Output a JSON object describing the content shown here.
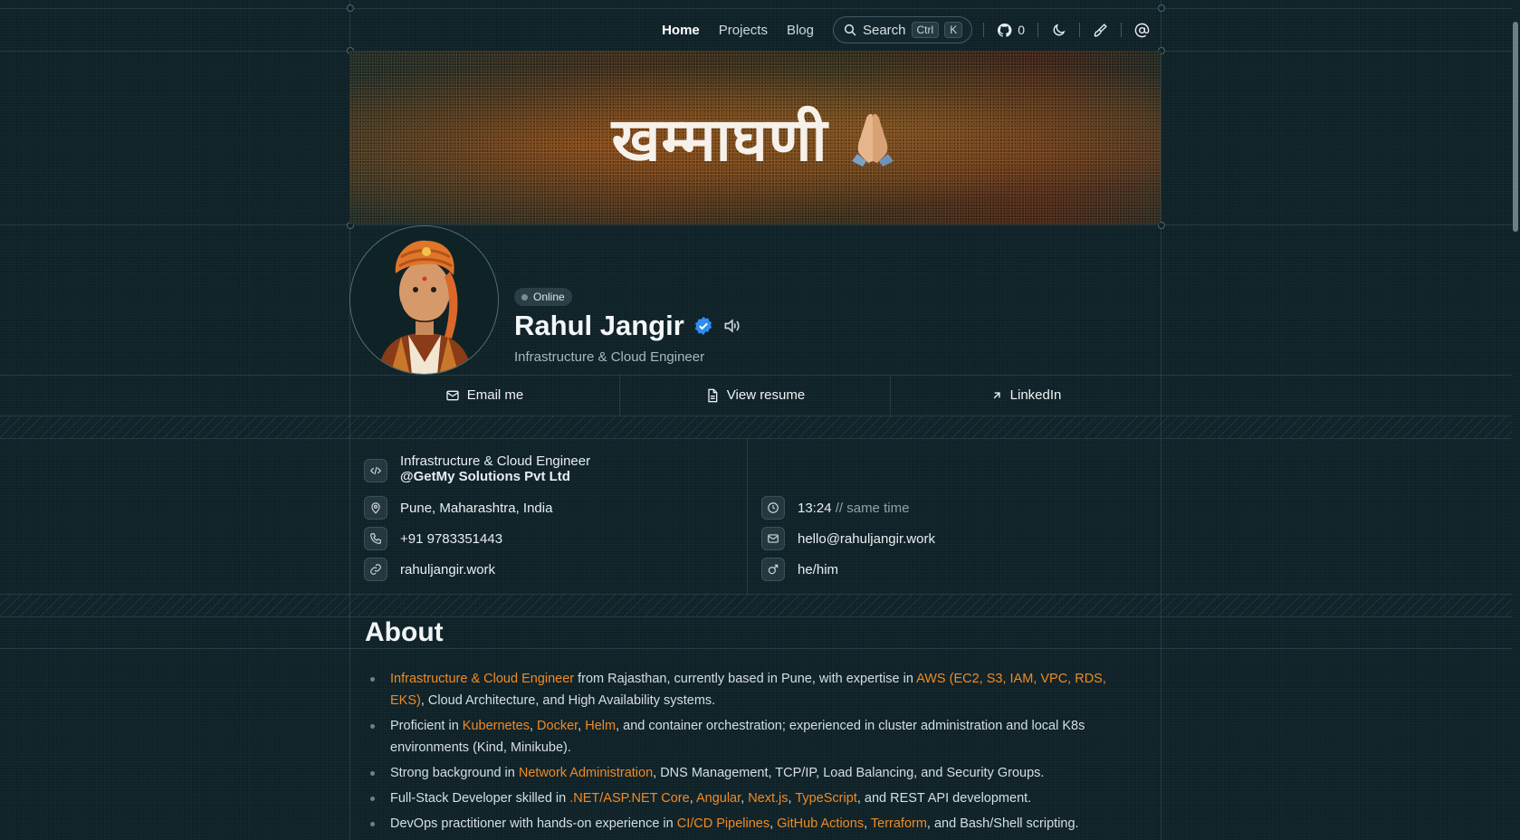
{
  "nav": {
    "links": [
      "Home",
      "Projects",
      "Blog"
    ],
    "search_label": "Search",
    "search_kbd": [
      "Ctrl",
      "K"
    ],
    "github_count": "0"
  },
  "banner": {
    "title": "खम्माघणी"
  },
  "profile": {
    "status": "Online",
    "name": "Rahul Jangir",
    "subtitle": "Infrastructure & Cloud Engineer"
  },
  "actions": {
    "email": "Email me",
    "resume": "View resume",
    "linkedin": "LinkedIn"
  },
  "info": {
    "role": "Infrastructure & Cloud Engineer",
    "company": "@GetMy Solutions Pvt Ltd",
    "location": "Pune, Maharashtra, India",
    "phone": "+91 9783351443",
    "website": "rahuljangir.work",
    "time": "13:24",
    "time_note": "// same time",
    "email": "hello@rahuljangir.work",
    "pronouns": "he/him"
  },
  "about": {
    "title": "About",
    "items": [
      [
        {
          "t": "Infrastructure & Cloud Engineer",
          "h": true
        },
        {
          "t": " from Rajasthan, currently based in Pune, with expertise in "
        },
        {
          "t": "AWS (EC2, S3, IAM, VPC, RDS, EKS)",
          "h": true
        },
        {
          "t": ", Cloud Architecture, and High Availability systems."
        }
      ],
      [
        {
          "t": "Proficient in "
        },
        {
          "t": "Kubernetes",
          "h": true
        },
        {
          "t": ", "
        },
        {
          "t": "Docker",
          "h": true
        },
        {
          "t": ", "
        },
        {
          "t": "Helm",
          "h": true
        },
        {
          "t": ", and container orchestration; experienced in cluster administration and local K8s environments (Kind, Minikube)."
        }
      ],
      [
        {
          "t": "Strong background in "
        },
        {
          "t": "Network Administration",
          "h": true
        },
        {
          "t": ", DNS Management, TCP/IP, Load Balancing, and Security Groups."
        }
      ],
      [
        {
          "t": "Full-Stack Developer skilled in "
        },
        {
          "t": ".NET/ASP.NET Core",
          "h": true
        },
        {
          "t": ", "
        },
        {
          "t": "Angular",
          "h": true
        },
        {
          "t": ", "
        },
        {
          "t": "Next.js",
          "h": true
        },
        {
          "t": ", "
        },
        {
          "t": "TypeScript",
          "h": true
        },
        {
          "t": ", and REST API development."
        }
      ],
      [
        {
          "t": "DevOps practitioner with hands-on experience in "
        },
        {
          "t": "CI/CD Pipelines",
          "h": true
        },
        {
          "t": ", "
        },
        {
          "t": "GitHub Actions",
          "h": true
        },
        {
          "t": ", "
        },
        {
          "t": "Terraform",
          "h": true
        },
        {
          "t": ", and Bash/Shell scripting."
        }
      ]
    ]
  },
  "colors": {
    "accent": "#f08a24",
    "background": "#0f2228",
    "verified": "#2f8cf0"
  }
}
